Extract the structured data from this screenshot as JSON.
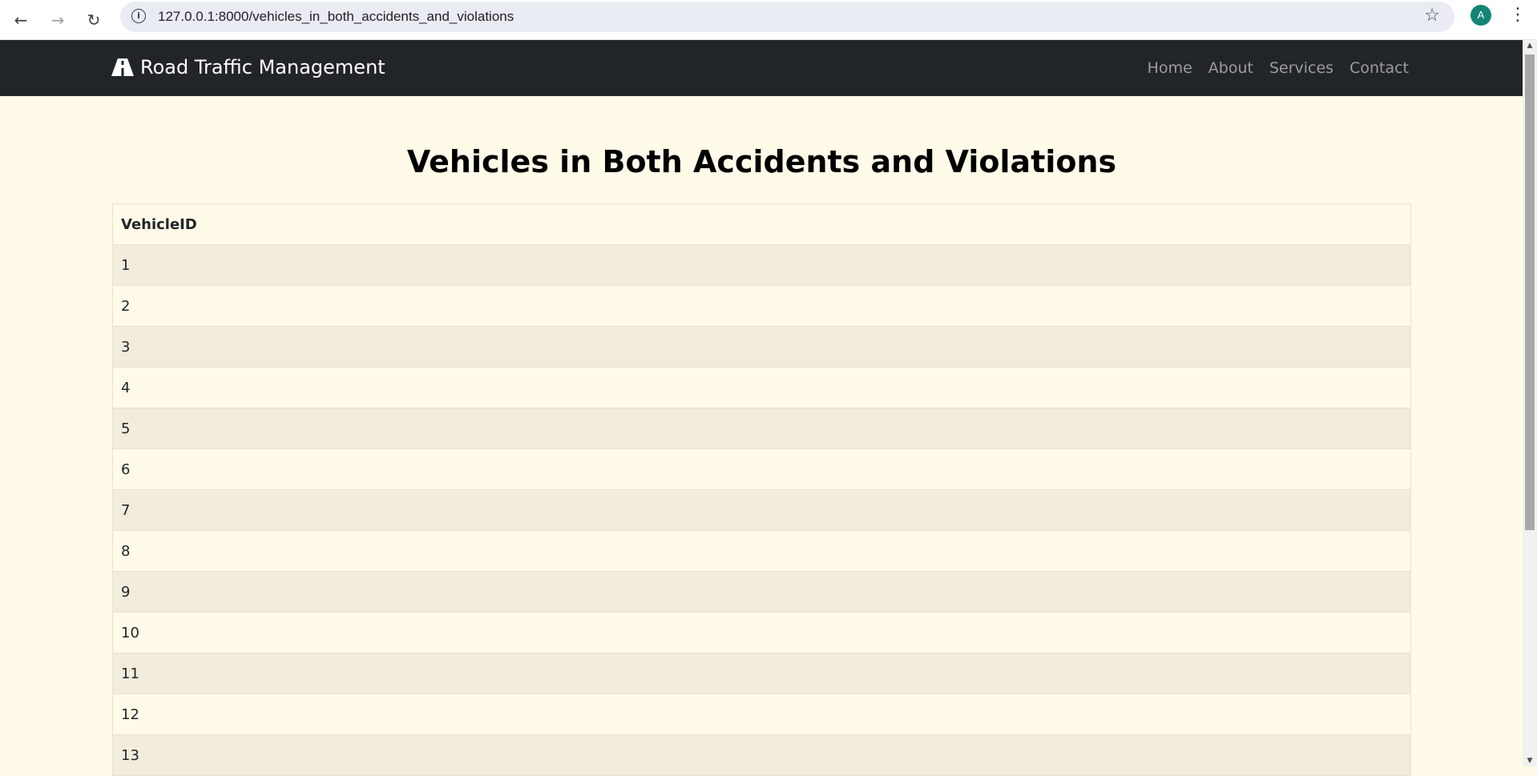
{
  "browser": {
    "url": "127.0.0.1:8000/vehicles_in_both_accidents_and_violations",
    "profile_initial": "A"
  },
  "navbar": {
    "brand": "Road Traffic Management",
    "links": [
      "Home",
      "About",
      "Services",
      "Contact"
    ]
  },
  "page": {
    "title": "Vehicles in Both Accidents and Violations"
  },
  "table": {
    "header": "VehicleID",
    "rows": [
      "1",
      "2",
      "3",
      "4",
      "5",
      "6",
      "7",
      "8",
      "9",
      "10",
      "11",
      "12",
      "13"
    ]
  },
  "colors": {
    "navbar_bg": "#212529",
    "page_bg": "#fffbe8",
    "striped_row": "#f1ecdc"
  }
}
